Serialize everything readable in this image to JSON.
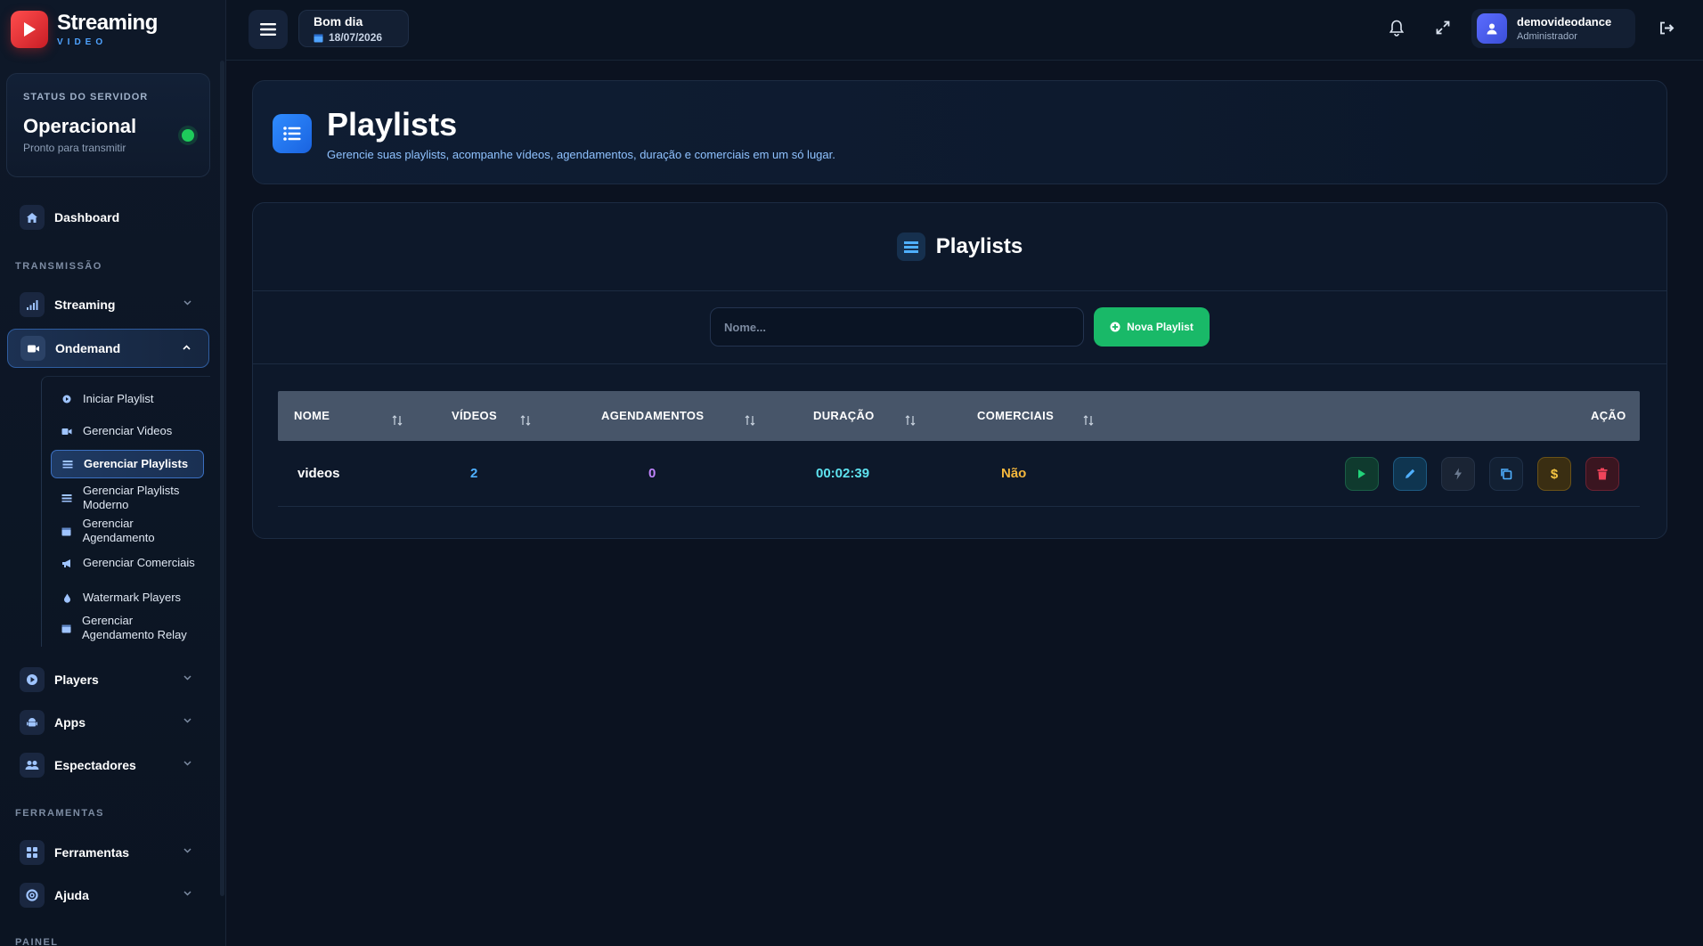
{
  "brand": {
    "title": "Streaming",
    "subtitle": "VIDEO"
  },
  "server": {
    "label": "STATUS DO SERVIDOR",
    "status": "Operacional",
    "sub": "Pronto para transmitir"
  },
  "nav": {
    "dashboard": "Dashboard",
    "section_transmissao": "TRANSMISSÃO",
    "streaming": "Streaming",
    "ondemand": "Ondemand",
    "ondemand_items": [
      "Iniciar Playlist",
      "Gerenciar Videos",
      "Gerenciar Playlists",
      "Gerenciar Playlists Moderno",
      "Gerenciar Agendamento",
      "Gerenciar Comerciais",
      "Watermark Players",
      "Gerenciar Agendamento Relay"
    ],
    "players": "Players",
    "apps": "Apps",
    "espectadores": "Espectadores",
    "section_ferramentas": "FERRAMENTAS",
    "ferramentas": "Ferramentas",
    "ajuda": "Ajuda",
    "section_painel": "PAINEL"
  },
  "topbar": {
    "greeting": "Bom dia",
    "date": "18/07/2026",
    "user_name": "demovideodance",
    "user_role": "Administrador"
  },
  "header": {
    "title": "Playlists",
    "subtitle": "Gerencie suas playlists, acompanhe vídeos, agendamentos, duração e comerciais em um só lugar."
  },
  "card": {
    "title": "Playlists",
    "search_placeholder": "Nome...",
    "new_button": "Nova Playlist"
  },
  "table": {
    "columns": [
      "NOME",
      "VÍDEOS",
      "AGENDAMENTOS",
      "DURAÇÃO",
      "COMERCIAIS",
      "AÇÃO"
    ],
    "rows": [
      {
        "nome": "videos",
        "videos": "2",
        "agendamentos": "0",
        "duracao": "00:02:39",
        "comerciais": "Não"
      }
    ]
  },
  "colors": {
    "accent_blue": "#2f8cff",
    "success_green": "#19b968",
    "videos_color": "#4fb0ff",
    "agendamentos_color": "#c084fc",
    "duracao_color": "#5ee3f0",
    "comerciais_color": "#f5b83d",
    "danger_red": "#f0445a"
  },
  "icons": {
    "brand": "play-icon",
    "dashboard": "home-icon",
    "streaming": "signal-icon",
    "ondemand": "video-camera-icon",
    "players": "play-circle-icon",
    "apps": "android-icon",
    "espectadores": "users-icon",
    "ferramentas": "grid-icon",
    "ajuda": "life-ring-icon",
    "actions": [
      "play-icon",
      "pencil-icon",
      "bolt-icon",
      "copy-icon",
      "dollar-icon",
      "trash-icon"
    ]
  }
}
